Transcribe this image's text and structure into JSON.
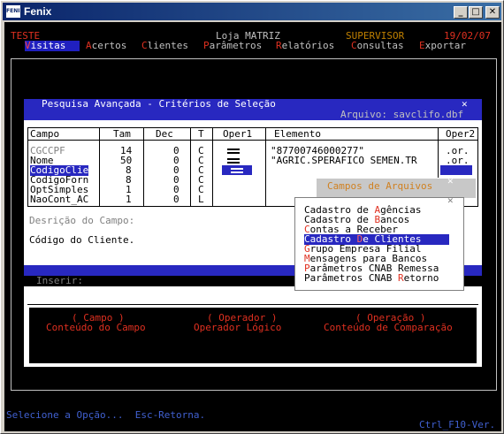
{
  "window": {
    "title": "Fenix",
    "icon": "fenix-app-icon",
    "min": "_",
    "max": "□",
    "close": "✕"
  },
  "header": {
    "company": "TESTE",
    "store": "Loja MATRIZ",
    "user": "SUPERVISOR",
    "date": "19/02/07"
  },
  "menu": [
    {
      "hot": "V",
      "rest": "isitas"
    },
    {
      "hot": "A",
      "rest": "certos"
    },
    {
      "hot": "C",
      "rest": "lientes"
    },
    {
      "hot": "P",
      "rest": "arâmetros"
    },
    {
      "hot": "R",
      "rest": "elatórios"
    },
    {
      "hot": "C",
      "rest": "onsultas"
    },
    {
      "hot": "E",
      "rest": "xportar"
    }
  ],
  "dialog": {
    "title": "Pesquisa Avançada - Critérios de Seleção",
    "close": "✕",
    "file_label": "Arquivo: savclifo.dbf",
    "columns": {
      "campo": "Campo",
      "tam": "Tam",
      "dec": "Dec",
      "t": "T",
      "oper1": "Oper1",
      "elemento": "Elemento",
      "oper2": "Oper2"
    },
    "rows": [
      {
        "campo": "CGCCPF",
        "tam": "14",
        "dec": "0",
        "t": "C",
        "elemento": "\"87700746000277\"",
        "oper2": ".or."
      },
      {
        "campo": "Nome",
        "tam": "50",
        "dec": "0",
        "t": "C",
        "elemento": "\"AGRIC.SPERAFICO SEMEN.TR",
        "oper2": ".or."
      },
      {
        "campo": "CodigoClie",
        "tam": "8",
        "dec": "0",
        "t": "C",
        "elemento": "",
        "oper2": ""
      },
      {
        "campo": "CodigoForn",
        "tam": "8",
        "dec": "0",
        "t": "C",
        "elemento": "",
        "oper2": ""
      },
      {
        "campo": "OptSimples",
        "tam": "1",
        "dec": "0",
        "t": "C",
        "elemento": "",
        "oper2": ""
      },
      {
        "campo": "NaoCont_AC",
        "tam": "1",
        "dec": "0",
        "t": "L",
        "elemento": "",
        "oper2": ""
      }
    ],
    "desc_label": "Desrição do Campo:",
    "desc_value": "Código do Cliente.",
    "insert_label": "Inserir:",
    "actions": [
      {
        "key": "( Campo )",
        "desc": "Conteúdo do Campo"
      },
      {
        "key": "( Operador )",
        "desc": "Operador Lógico"
      },
      {
        "key": "( Operação )",
        "desc": "Conteúdo de Comparação"
      }
    ]
  },
  "popup": {
    "title": "Campos de Arquivos",
    "close": "✕",
    "items": [
      {
        "pre": "Cadastro de ",
        "hot": "A",
        "post": "gências"
      },
      {
        "pre": "Cadastro de ",
        "hot": "B",
        "post": "ancos"
      },
      {
        "pre": "",
        "hot": "C",
        "post": "ontas a Receber"
      },
      {
        "pre": "Cadastro ",
        "hot": "D",
        "post": "e Clientes"
      },
      {
        "pre": "",
        "hot": "G",
        "post": "rupo Empresa Filial"
      },
      {
        "pre": "",
        "hot": "M",
        "post": "ensagens para Bancos"
      },
      {
        "pre": "",
        "hot": "P",
        "post": "arâmetros CNAB Remessa"
      },
      {
        "pre": "Parâmetros CNAB ",
        "hot": "R",
        "post": "etorno"
      }
    ],
    "selected_index": 3
  },
  "status": {
    "left": "Selecione a Opção...  Esc-Retorna.",
    "right": "Ctrl_F10-Ver."
  }
}
